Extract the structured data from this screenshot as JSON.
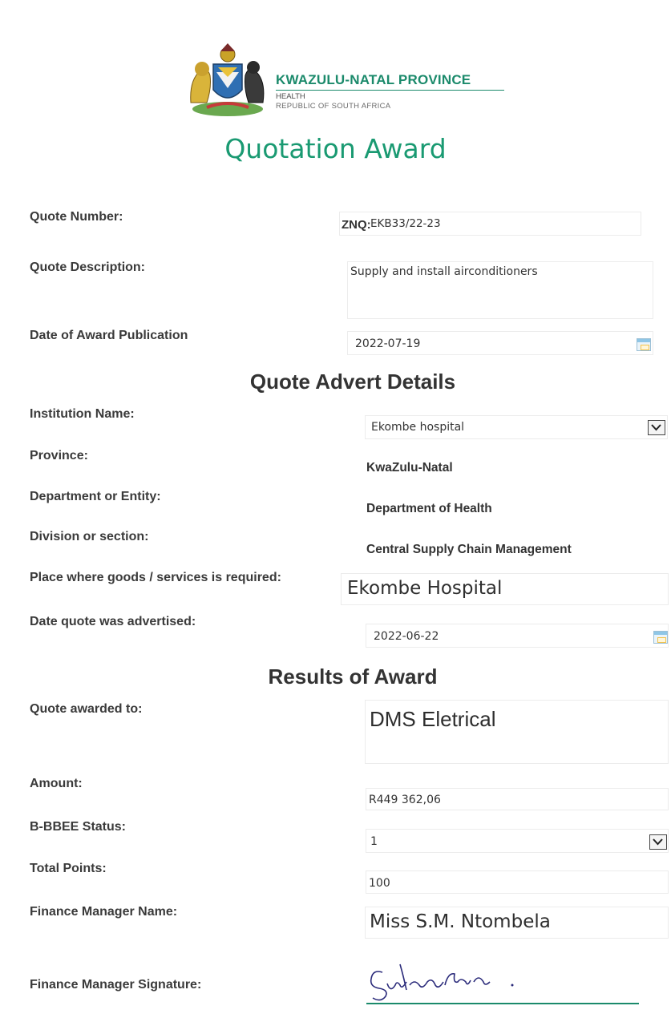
{
  "header": {
    "province": "KWAZULU-NATAL PROVINCE",
    "department": "HEALTH",
    "country": "REPUBLIC OF SOUTH AFRICA",
    "title": "Quotation Award"
  },
  "quote": {
    "number_label": "Quote Number:",
    "number_prefix": "ZNQ:",
    "number_value": "EKB33/22-23",
    "description_label": "Quote Description:",
    "description_value": "Supply and install airconditioners",
    "award_date_label": "Date of Award Publication",
    "award_date_value": "2022-07-19"
  },
  "advert": {
    "heading": "Quote Advert Details",
    "institution_label": "Institution Name:",
    "institution_value": "Ekombe hospital",
    "province_label": "Province:",
    "province_value": "KwaZulu-Natal",
    "department_label": "Department or Entity:",
    "department_value": "Department of Health",
    "division_label": "Division or section:",
    "division_value": "Central Supply Chain Management",
    "place_label": "Place where goods /  services is required:",
    "place_value": "Ekombe Hospital",
    "advertised_label": "Date quote was advertised:",
    "advertised_value": "2022-06-22"
  },
  "results": {
    "heading": "Results of Award",
    "awarded_label": "Quote awarded to:",
    "awarded_value": "DMS Eletrical",
    "amount_label": "Amount:",
    "amount_value": "R449 362,06",
    "bbbee_label": "B-BBEE Status:",
    "bbbee_value": "1",
    "points_label": "Total Points:",
    "points_value": "100",
    "fm_name_label": "Finance Manager Name:",
    "fm_name_value": "Miss S.M. Ntombela",
    "fm_signature_label": "Finance Manager Signature:"
  },
  "colors": {
    "brand_green": "#1b8a6b",
    "title_green": "#1a9a72"
  },
  "icons": [
    "coat-of-arms",
    "calendar-icon",
    "dropdown-arrow-icon"
  ]
}
